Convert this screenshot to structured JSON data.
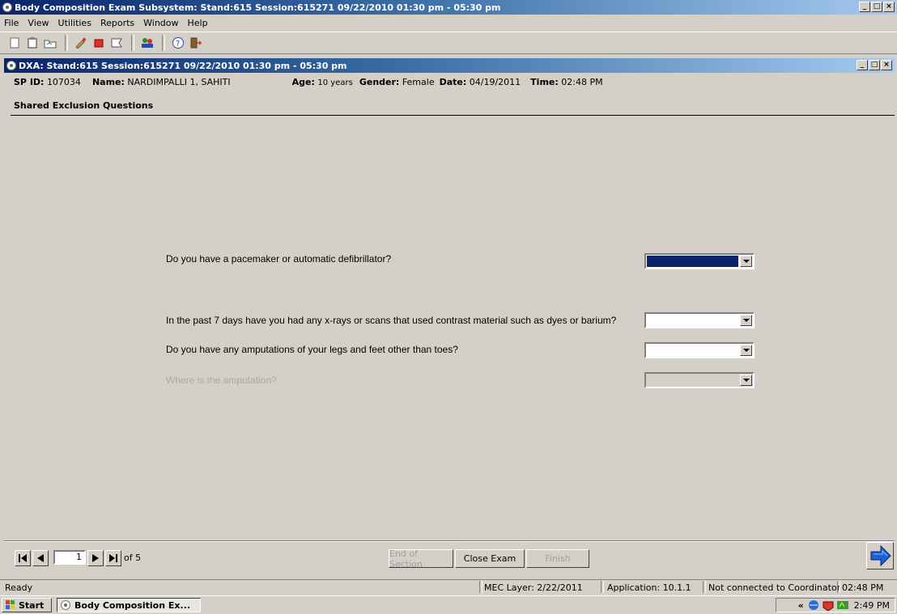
{
  "window": {
    "title": "Body Composition Exam Subsystem: Stand:615 Session:615271 09/22/2010 01:30 pm - 05:30 pm",
    "controls": [
      "_",
      "□",
      "×"
    ]
  },
  "menu": [
    "File",
    "View",
    "Utilities",
    "Reports",
    "Window",
    "Help"
  ],
  "toolbar": {
    "icons": [
      "new-icon",
      "clipboard-icon",
      "folder-icon",
      "edit-icon",
      "stop-icon",
      "flag-icon",
      "people-icon",
      "help-icon",
      "exit-icon"
    ]
  },
  "child_window": {
    "title": "DXA: Stand:615 Session:615271 09/22/2010 01:30 pm - 05:30 pm"
  },
  "participant": {
    "sp_id_label": "SP ID:",
    "sp_id": "107034",
    "name_label": "Name:",
    "name": "NARDIMPALLI 1, SAHITI",
    "age_label": "Age:",
    "age": "10 years",
    "gender_label": "Gender:",
    "gender": "Female",
    "date_label": "Date:",
    "date": "04/19/2011",
    "time_label": "Time:",
    "time": "02:48 PM"
  },
  "section": {
    "title": "Shared Exclusion Questions"
  },
  "questions": [
    {
      "text": "Do you have a pacemaker or automatic defibrillator?",
      "value": "",
      "state": "selected"
    },
    {
      "text": "In the past 7 days have you had any x-rays or scans that used contrast material such as dyes or barium?",
      "value": "",
      "state": "normal"
    },
    {
      "text": "Do you have any amputations of your legs and feet other than toes?",
      "value": "",
      "state": "normal"
    },
    {
      "text": "Where is the amputation?",
      "value": "",
      "state": "disabled"
    }
  ],
  "navigation": {
    "page": "1",
    "of_label": "of 5",
    "end_of_section": "End of Section",
    "close_exam": "Close Exam",
    "finish": "Finish"
  },
  "status": {
    "ready": "Ready",
    "mec_layer": "MEC Layer: 2/22/2011",
    "application": "Application: 10.1.1",
    "coordinator": "Not connected to Coordinator",
    "time": "02:48 PM"
  },
  "taskbar": {
    "start": "Start",
    "task": "Body Composition Ex...",
    "tray_chevron": "«",
    "clock": "2:49 PM"
  }
}
